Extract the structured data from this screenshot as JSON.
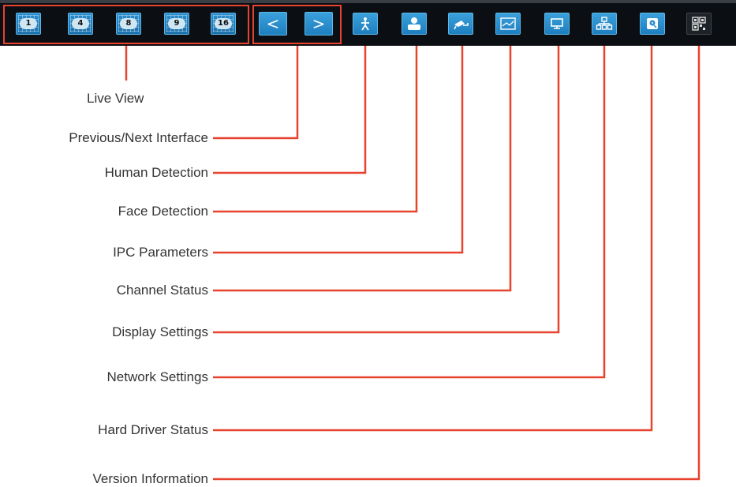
{
  "toolbar": {
    "live_view_buttons": [
      "1",
      "4",
      "8",
      "9",
      "16"
    ],
    "prev_label": "<",
    "next_label": ">"
  },
  "callouts": [
    "Live View",
    "Previous/Next Interface",
    "Human Detection",
    "Face Detection",
    "IPC Parameters",
    "Channel Status",
    "Display Settings",
    "Network Settings",
    "Hard Driver Status",
    "Version Information"
  ],
  "colors": {
    "toolbar_bg": "#0b0e12",
    "button_blue": "#2a8fd0",
    "callout_red": "#e7432e",
    "label_text": "#333333"
  },
  "icons": [
    "human-detection-icon",
    "face-detection-icon",
    "ipc-camera-icon",
    "channel-status-icon",
    "display-monitor-icon",
    "network-icon",
    "hard-drive-icon",
    "qr-code-icon"
  ]
}
